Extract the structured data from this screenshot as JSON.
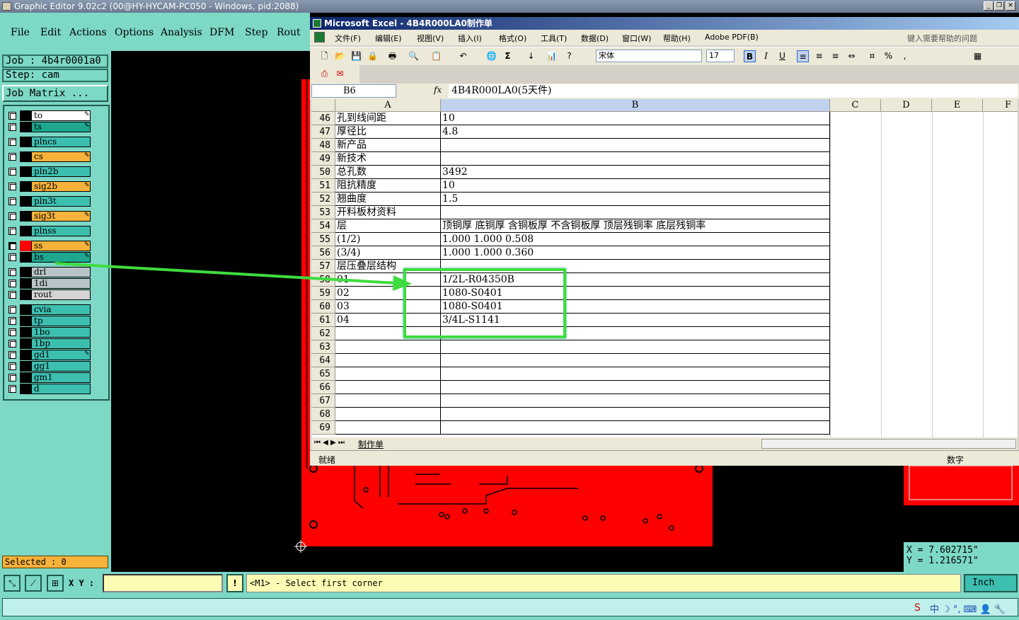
{
  "genesis": {
    "title": "Graphic Editor 9.02c2 (00@HY-HYCAM-PC050 - Windows, pid:2088)",
    "menu": [
      "File",
      "Edit",
      "Actions",
      "Options",
      "Analysis",
      "DFM",
      "Step",
      "Rout"
    ],
    "job_label": "Job : 4b4r0001a0",
    "step_label": "Step: cam",
    "job_matrix_button": "Job Matrix ...",
    "layers": [
      {
        "name": "to",
        "color": "#ffffff",
        "pen": true
      },
      {
        "name": "ts",
        "color": "#1fa890",
        "pen": true
      },
      {
        "name": "plncs",
        "color": "#3dbfb0",
        "pen": false
      },
      {
        "name": "cs",
        "color": "#f6b23a",
        "pen": true
      },
      {
        "name": "pln2b",
        "color": "#3dbfb0",
        "pen": false
      },
      {
        "name": "sig2b",
        "color": "#f6b23a",
        "pen": true
      },
      {
        "name": "pln3t",
        "color": "#3dbfb0",
        "pen": false
      },
      {
        "name": "sig3t",
        "color": "#f6b23a",
        "pen": true
      },
      {
        "name": "plnss",
        "color": "#3dbfb0",
        "pen": false
      },
      {
        "name": "ss",
        "color": "#f6b23a",
        "pen": true
      },
      {
        "name": "bs",
        "color": "#1fa890",
        "pen": true
      },
      {
        "name": "drl",
        "color": "#b8c4c8",
        "pen": false
      },
      {
        "name": "1di",
        "color": "#b8c4c8",
        "pen": false
      },
      {
        "name": "rout",
        "color": "#d4d4d4",
        "pen": false
      },
      {
        "name": "cvia",
        "color": "#3dbfb0",
        "pen": false
      },
      {
        "name": "tp",
        "color": "#3dbfb0",
        "pen": false
      },
      {
        "name": "1bo",
        "color": "#3dbfb0",
        "pen": false
      },
      {
        "name": "1bp",
        "color": "#3dbfb0",
        "pen": false
      },
      {
        "name": "gd1",
        "color": "#3dbfb0",
        "pen": true
      },
      {
        "name": "gg1",
        "color": "#3dbfb0",
        "pen": false
      },
      {
        "name": "gm1",
        "color": "#3dbfb0",
        "pen": false
      },
      {
        "name": "d",
        "color": "#3dbfb0",
        "pen": false
      }
    ],
    "selected_label": "Selected : 0",
    "xy_label": "X Y :",
    "xy_value": "",
    "prompt": "<M1> - Select first corner",
    "units": "Inch",
    "coord_x": "X  =  7.602715\"",
    "coord_y": "Y  =  1.216571\""
  },
  "excel": {
    "title": "Microsoft Excel - 4B4R000LA0制作单",
    "menu": [
      "文件(F)",
      "编辑(E)",
      "视图(V)",
      "插入(I)",
      "格式(O)",
      "工具(T)",
      "数据(D)",
      "窗口(W)",
      "帮助(H)",
      "Adobe PDF(B)"
    ],
    "help_placeholder": "键入需要帮助的问题",
    "font_name": "宋体",
    "font_size": "17",
    "name_box": "B6",
    "formula": "4B4R000LA0(5天件)",
    "columns": [
      "A",
      "B",
      "C",
      "D",
      "E",
      "F"
    ],
    "rows": [
      {
        "n": "46",
        "a": "孔到线间距",
        "b": "10"
      },
      {
        "n": "47",
        "a": "厚径比",
        "b": "4.8"
      },
      {
        "n": "48",
        "a": "新产品",
        "b": ""
      },
      {
        "n": "49",
        "a": "新技术",
        "b": ""
      },
      {
        "n": "50",
        "a": "总孔数",
        "b": "3492"
      },
      {
        "n": "51",
        "a": "阻抗精度",
        "b": "10"
      },
      {
        "n": "52",
        "a": "翘曲度",
        "b": "1.5"
      },
      {
        "n": "53",
        "a": "开料板材资料",
        "b": ""
      },
      {
        "n": "54",
        "a": "层",
        "b": "顶铜厚  底铜厚  含铜板厚  不含铜板厚  顶层残铜率  底层残铜率"
      },
      {
        "n": "55",
        "a": "(1/2)",
        "b": "1.000  1.000          0.508"
      },
      {
        "n": "56",
        "a": "(3/4)",
        "b": "1.000  1.000          0.360"
      },
      {
        "n": "57",
        "a": "层压叠层结构",
        "b": ""
      },
      {
        "n": "58",
        "a": "01",
        "b": "1/2L-R04350B"
      },
      {
        "n": "59",
        "a": "02",
        "b": "1080-S0401"
      },
      {
        "n": "60",
        "a": "03",
        "b": "1080-S0401"
      },
      {
        "n": "61",
        "a": "04",
        "b": "3/4L-S1141"
      },
      {
        "n": "62",
        "a": "",
        "b": ""
      },
      {
        "n": "63",
        "a": "",
        "b": ""
      },
      {
        "n": "64",
        "a": "",
        "b": ""
      },
      {
        "n": "65",
        "a": "",
        "b": ""
      },
      {
        "n": "66",
        "a": "",
        "b": ""
      },
      {
        "n": "67",
        "a": "",
        "b": ""
      },
      {
        "n": "68",
        "a": "",
        "b": ""
      },
      {
        "n": "69",
        "a": "",
        "b": ""
      }
    ],
    "sheet_tab": "制作单",
    "status_ready": "就绪",
    "status_num": "数字"
  },
  "colors": {
    "panel": "#7dd8c6",
    "board": "#ff0000",
    "highlight": "#3fdc3f",
    "orange": "#f6b23a"
  }
}
